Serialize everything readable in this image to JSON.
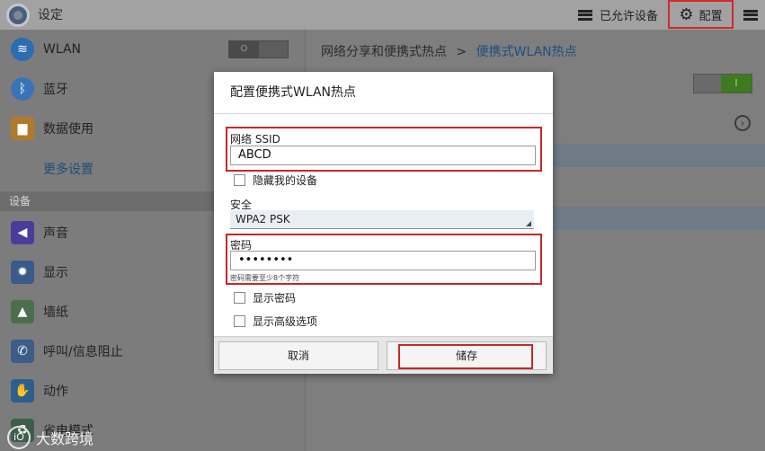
{
  "app": {
    "title": "设定"
  },
  "actionbar": {
    "allowed_devices": "已允许设备",
    "config": "配置"
  },
  "left": {
    "items": [
      {
        "label": "WLAN",
        "icon": "wifi-icon"
      },
      {
        "label": "蓝牙",
        "icon": "bluetooth-icon"
      },
      {
        "label": "数据使用",
        "icon": "data-usage-icon"
      }
    ],
    "more_settings": "更多设置",
    "section_device": "设备",
    "device_items": [
      {
        "label": "声音",
        "icon": "sound-icon"
      },
      {
        "label": "显示",
        "icon": "display-icon"
      },
      {
        "label": "墙纸",
        "icon": "wallpaper-icon"
      },
      {
        "label": "呼叫/信息阻止",
        "icon": "call-block-icon"
      },
      {
        "label": "动作",
        "icon": "motion-icon"
      },
      {
        "label": "省电模式",
        "icon": "power-saving-icon"
      }
    ]
  },
  "right": {
    "breadcrumb_parent": "网络分享和便携式热点",
    "breadcrumb_sep": ">",
    "breadcrumb_current": "便携式WLAN热点"
  },
  "dialog": {
    "title": "配置便携式WLAN热点",
    "ssid_label": "网络 SSID",
    "ssid_value": "ABCD",
    "hide_device_label": "隐藏我的设备",
    "security_label": "安全",
    "security_value": "WPA2 PSK",
    "password_label": "密码",
    "password_value": "••••••••",
    "password_hint": "密码需要至少8个字符",
    "show_password_label": "显示密码",
    "show_advanced_label": "显示高级选项",
    "cancel_label": "取消",
    "save_label": "储存"
  },
  "watermark": {
    "text": "大数跨境",
    "logo": "iO"
  },
  "colors": {
    "highlight": "#c62828",
    "accent": "#1f4f7e"
  }
}
